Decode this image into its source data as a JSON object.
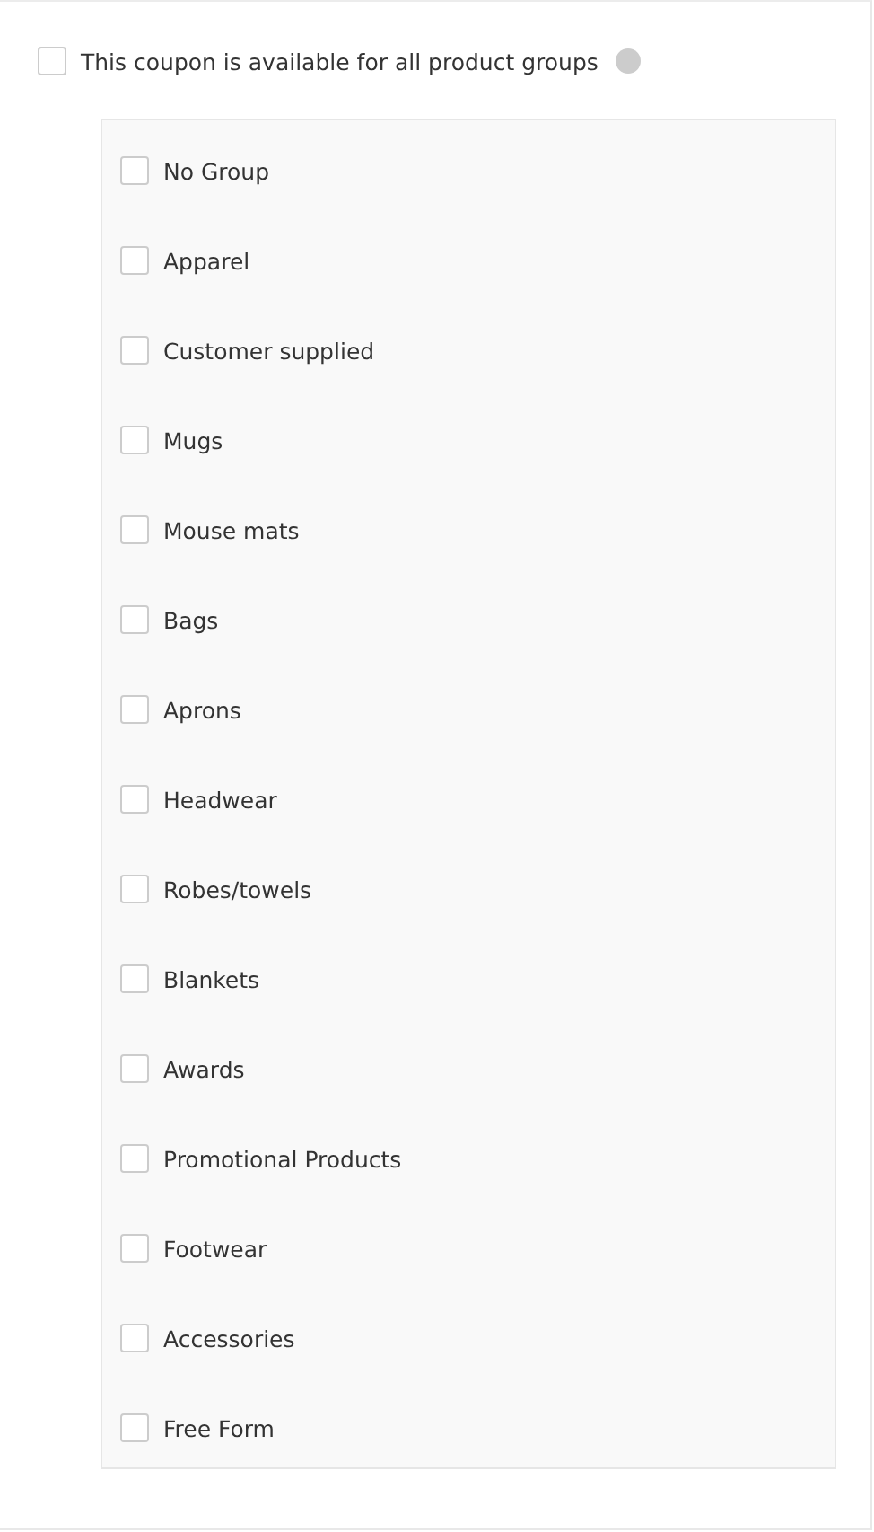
{
  "all_groups": {
    "label": "This coupon is available for all product groups",
    "checked": false
  },
  "groups": [
    {
      "label": "No Group",
      "checked": false
    },
    {
      "label": "Apparel",
      "checked": false
    },
    {
      "label": "Customer supplied",
      "checked": false
    },
    {
      "label": "Mugs",
      "checked": false
    },
    {
      "label": "Mouse mats",
      "checked": false
    },
    {
      "label": "Bags",
      "checked": false
    },
    {
      "label": "Aprons",
      "checked": false
    },
    {
      "label": "Headwear",
      "checked": false
    },
    {
      "label": "Robes/towels",
      "checked": false
    },
    {
      "label": "Blankets",
      "checked": false
    },
    {
      "label": "Awards",
      "checked": false
    },
    {
      "label": "Promotional Products",
      "checked": false
    },
    {
      "label": "Footwear",
      "checked": false
    },
    {
      "label": "Accessories",
      "checked": false
    },
    {
      "label": "Free Form",
      "checked": false
    }
  ]
}
